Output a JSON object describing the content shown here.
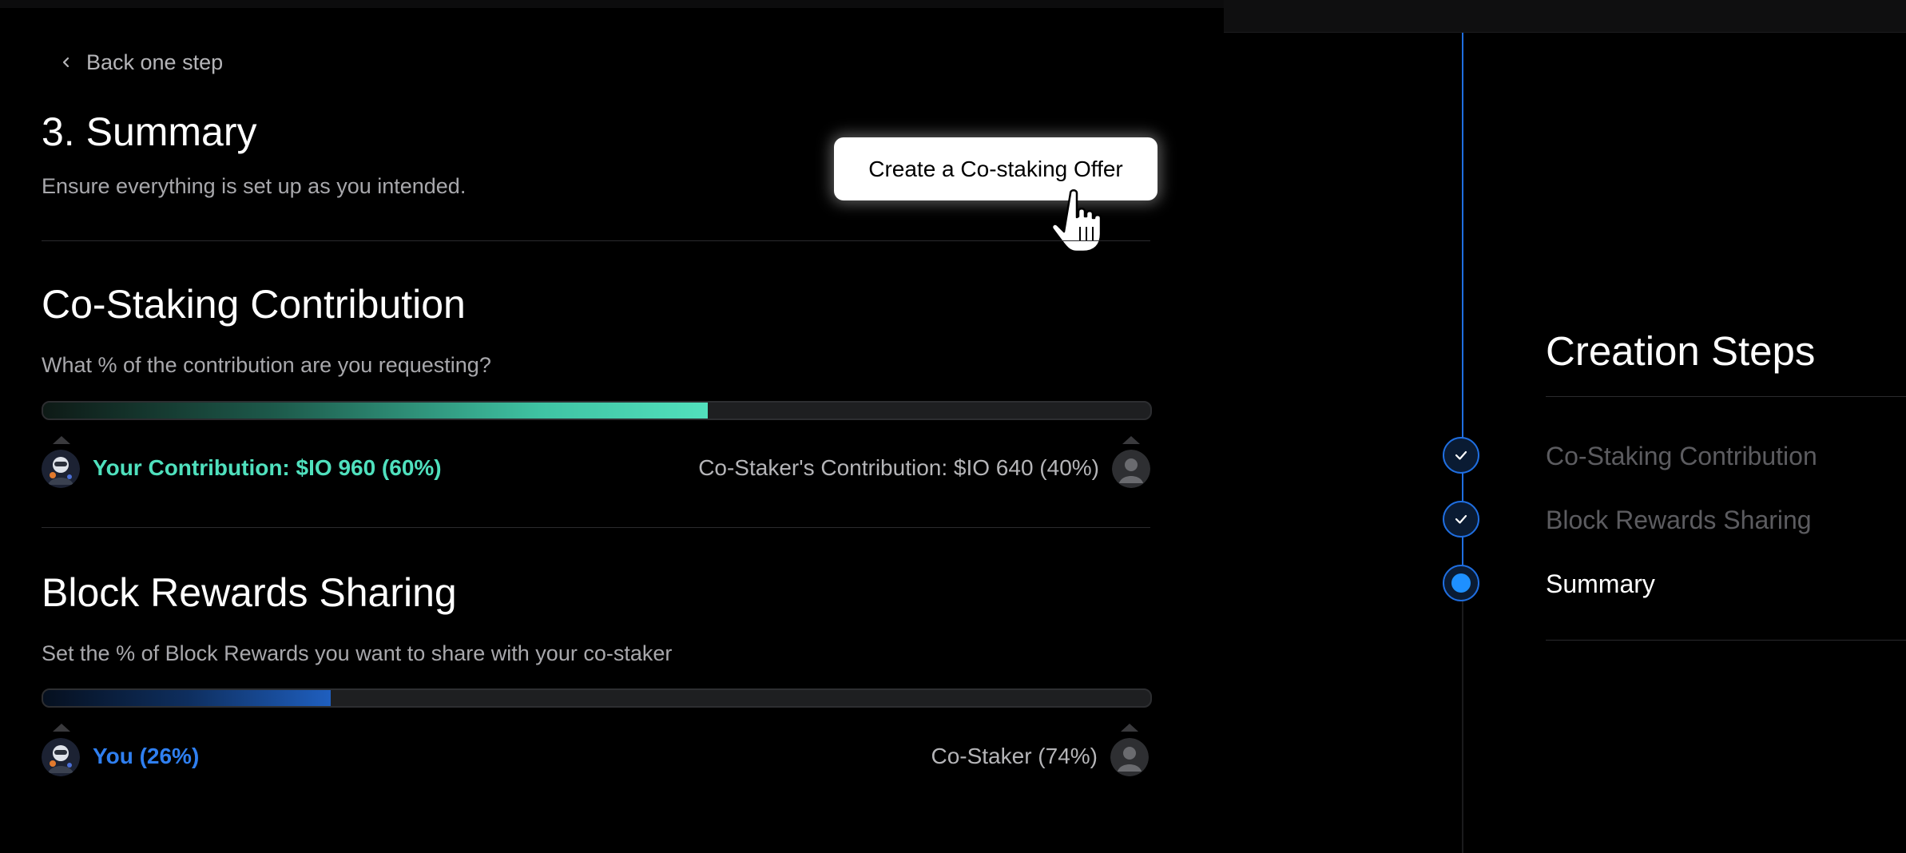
{
  "nav": {
    "back_label": "Back one step"
  },
  "header": {
    "title": "3. Summary",
    "subtitle": "Ensure everything is set up as you intended.",
    "create_button": "Create a Co-staking Offer"
  },
  "contribution": {
    "title": "Co-Staking Contribution",
    "question": "What % of the contribution are you requesting?",
    "you_percent": 60,
    "you_label": "Your Contribution: $IO 960 (60%)",
    "other_label": "Co-Staker's Contribution: $IO 640 (40%)"
  },
  "rewards": {
    "title": "Block Rewards Sharing",
    "question": "Set the % of Block Rewards you want to share with your co-staker",
    "you_percent": 26,
    "you_label": "You (26%)",
    "other_label": "Co-Staker (74%)"
  },
  "steps": {
    "title": "Creation Steps",
    "items": [
      {
        "label": "Co-Staking Contribution",
        "state": "completed"
      },
      {
        "label": "Block Rewards Sharing",
        "state": "completed"
      },
      {
        "label": "Summary",
        "state": "current"
      }
    ]
  },
  "colors": {
    "accent_teal": "#4fe0bd",
    "accent_blue": "#2f7ff0",
    "step_blue": "#1f6ee0"
  }
}
